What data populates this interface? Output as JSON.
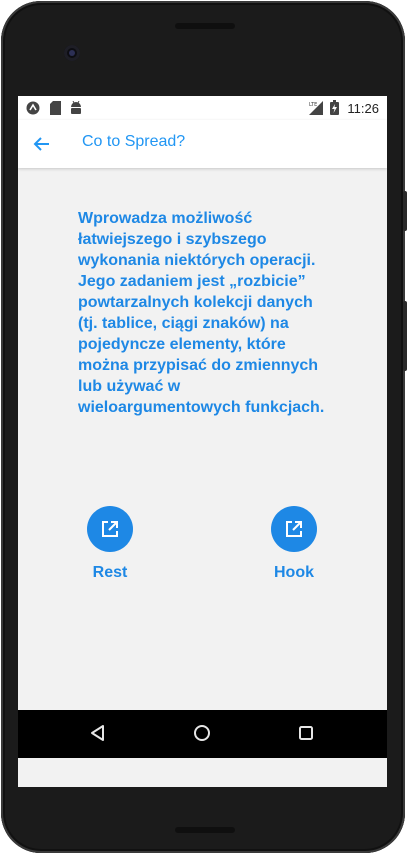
{
  "status_bar": {
    "time": "11:26",
    "left_icons": [
      "app-notification-icon",
      "sd-card-icon",
      "android-debug-icon"
    ],
    "right_icons": [
      "lte-signal-icon",
      "battery-charging-icon"
    ]
  },
  "app_bar": {
    "back_icon": "arrow-back-icon",
    "title": "Co to Spread?"
  },
  "content": {
    "description": "Wprowadza możliwość łatwiejszego i szybszego wykonania niektórych operacji. Jego zadaniem jest „rozbicie” powtarzalnych kolekcji danych (tj. tablice, ciągi znaków) na pojedyncze elementy, które można przypisać do zmiennych lub używać w wieloargumentowych funkcjach."
  },
  "links": [
    {
      "label": "Rest",
      "icon": "open-in-new-icon"
    },
    {
      "label": "Hook",
      "icon": "open-in-new-icon"
    }
  ],
  "nav_bar": {
    "icons": [
      "nav-back-icon",
      "nav-home-icon",
      "nav-recents-icon"
    ]
  },
  "colors": {
    "accent": "#1e88e5",
    "title": "#2196f3",
    "background": "#f2f2f2"
  }
}
